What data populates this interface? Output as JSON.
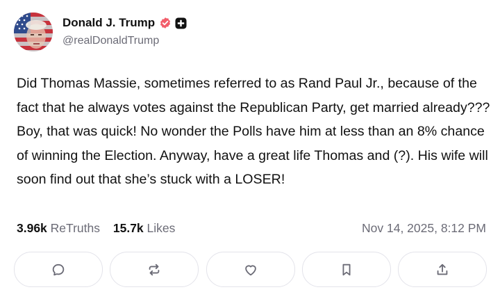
{
  "author": {
    "name": "Donald J. Trump",
    "handle": "@realDonaldTrump",
    "verified": true,
    "verified_color": "#f25d6a"
  },
  "post": {
    "text": "Did Thomas Massie, sometimes referred to as Rand Paul Jr., because of the fact that he always votes against the Republican Party, get married already??? Boy, that was quick! No wonder the Polls have him at less than an 8% chance of winning the Election. Anyway, have a great life Thomas and (?). His wife will soon find out that she’s stuck with a LOSER!"
  },
  "stats": {
    "retruths_count": "3.96k",
    "retruths_label": "ReTruths",
    "likes_count": "15.7k",
    "likes_label": "Likes"
  },
  "timestamp": "Nov 14, 2025, 8:12 PM",
  "actions": [
    {
      "name": "reply",
      "icon": "comment-icon"
    },
    {
      "name": "retruth",
      "icon": "repost-icon"
    },
    {
      "name": "like",
      "icon": "heart-icon"
    },
    {
      "name": "bookmark",
      "icon": "bookmark-icon"
    },
    {
      "name": "share",
      "icon": "share-icon"
    }
  ],
  "colors": {
    "text": "#111111",
    "muted": "#6b6b76",
    "border": "#e3e3ea",
    "icon": "#6b6b76"
  }
}
